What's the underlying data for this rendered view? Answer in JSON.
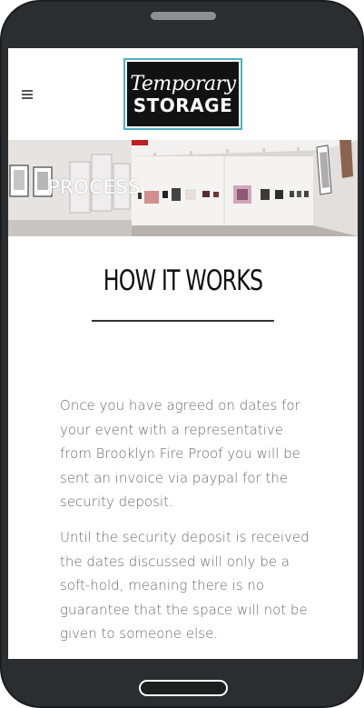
{
  "header": {
    "logo": {
      "line1": "Temporary",
      "line2": "STORAGE",
      "border_color": "#4fb0c6"
    }
  },
  "hero": {
    "title": "PROCESS"
  },
  "content": {
    "heading": "HOW IT WORKS",
    "paragraphs": [
      "Once you have agreed on dates for your event with a representative from Brooklyn Fire Proof you will be sent an invoice via paypal for the security deposit.",
      "Until the security deposit is received the dates discussed will only be a soft-hold, meaning there is no guarantee that the space will not be given to someone else."
    ]
  },
  "icons": {
    "menu": "hamburger-menu-icon"
  }
}
